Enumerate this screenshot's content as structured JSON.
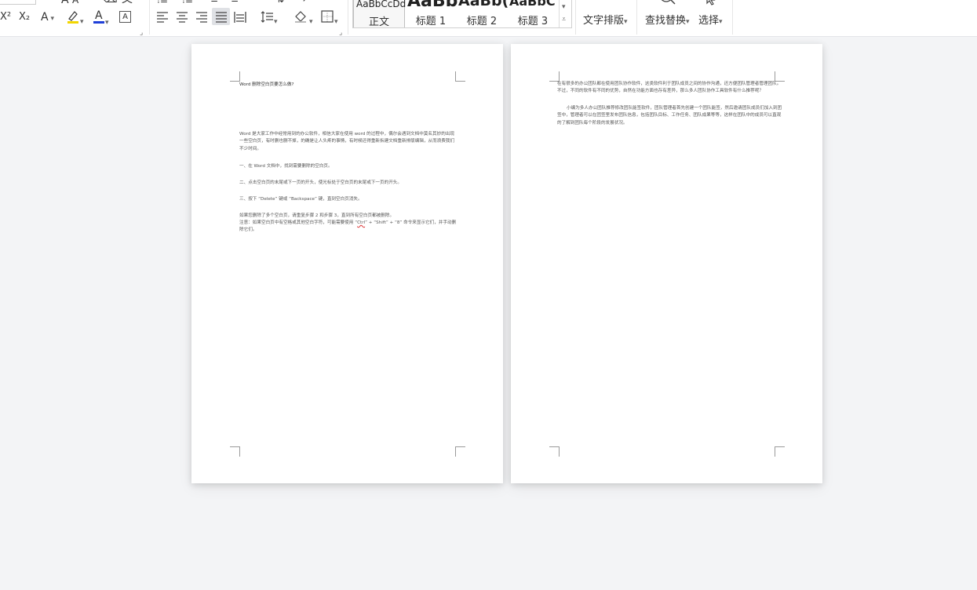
{
  "ribbon": {
    "superscript": "X²",
    "subscript": "X₂",
    "char_effect": "A",
    "font_color": "A",
    "char_border": "A",
    "styles": [
      {
        "sample": "AaBbCcDd",
        "label": "正文"
      },
      {
        "sample": "AaBb",
        "label": "标题 1"
      },
      {
        "sample": "AaBb(",
        "label": "标题 2"
      },
      {
        "sample": "AaBbC",
        "label": "标题 3"
      }
    ],
    "text_layout": "文字排版",
    "find_replace": "查找替换",
    "select": "选择",
    "highlight_color": "#f2d600",
    "font_color_bar": "#1f3fd8"
  },
  "page1": {
    "title": "Word 删除空白页要怎么做?",
    "intro": "Word 是大家工作中经常用到的办公软件，相信大家在使用 word 的过程中，偶尔会遇到文档中莫名其妙的出现一些空白页，有时删也删不掉，的确是让人头疼的事情，有时候还得重新拆建文档重新排版编辑，从而浪费我们不少时间。",
    "step1": "一、在 Word 文档中，找到需要删除的空白页。",
    "step2": "二、点击空白页的末尾或下一页的开头，使光标处于空白页的末尾或下一页的开头。",
    "step3": "三、按下 “Delete” 键或 “Backspace” 键，直到空白页消失。",
    "repeat": "如果您删除了多个空白页，请重复步骤 2 和步骤 3，直到所有空白页都被删除。",
    "note_pre": "注意：如果空白页中有空格或其他空白字符，可能需要使用 “",
    "note_ctrl": "Ctrl",
    "note_post": "” + “Shift” + “8” 命令来显示它们，并手动删除它们。"
  },
  "page2": {
    "para1": "在有很多的办公团队都在使用团队协作软件，这类软件利于团队成员之间的协作沟通，还方便团队管理者管理团队。不过，不同的软件有不同的优势，自然在功能方面也存有差异，那么多人团队协作工具软件有什么推荐呢？",
    "para2": "小编为多人办公团队推荐修改团队能签软件，团队管理者首先创建一个团队能签，然后邀请团队成员们加入到团签中，管理者可以在团签里发布团队信息，包括团队目标、工作任务、团队成果等等，这样在团队中的成员可以直观的了解到团队每个阶段的发展状况。"
  }
}
